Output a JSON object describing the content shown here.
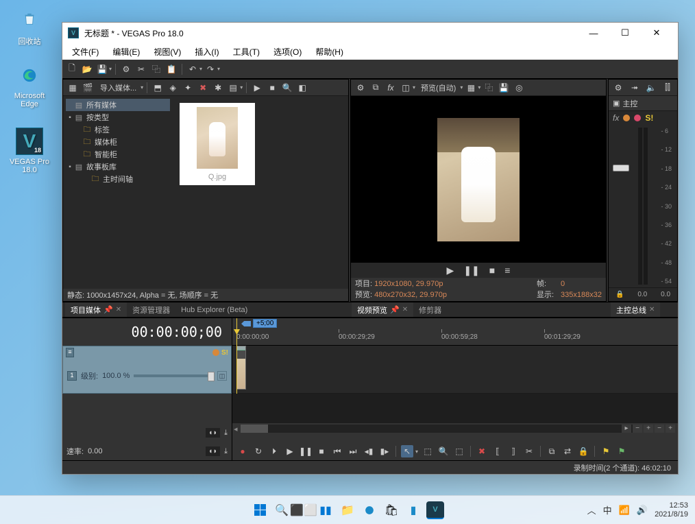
{
  "desktop": {
    "recycle": "回收站",
    "edge": "Microsoft\nEdge",
    "vegas": "VEGAS Pro\n18.0"
  },
  "window": {
    "title": "无标题 * - VEGAS Pro 18.0"
  },
  "menu": {
    "file": "文件(F)",
    "edit": "编辑(E)",
    "view": "视图(V)",
    "insert": "插入(I)",
    "tools": "工具(T)",
    "options": "选项(O)",
    "help": "帮助(H)"
  },
  "project_media": {
    "import_btn": "导入媒体...",
    "tree": {
      "all_media": "所有媒体",
      "by_type": "按类型",
      "tags": "标签",
      "media_bins": "媒体柜",
      "smart_bins": "智能柜",
      "storyboard": "故事板库",
      "main_timeline": "主时间轴"
    },
    "thumb_name": "Q.jpg",
    "status": "静态: 1000x1457x24, Alpha = 无, 场顺序 = 无"
  },
  "dock_tabs_left": {
    "project_media": "项目媒体",
    "explorer": "资源管理器",
    "hub": "Hub Explorer (Beta)"
  },
  "preview": {
    "quality_label": "预览(自动)",
    "project_label": "项目:",
    "project_val": "1920x1080, 29.970p",
    "frame_label": "帧:",
    "frame_val": "0",
    "preview_label": "预览:",
    "preview_val": "480x270x32, 29.970p",
    "display_label": "显示:",
    "display_val": "335x188x32"
  },
  "dock_tabs_center": {
    "video_preview": "视频预览",
    "trimmer": "修剪器"
  },
  "master": {
    "title": "主控",
    "scale": [
      "6",
      "12",
      "18",
      "24",
      "30",
      "36",
      "42",
      "48",
      "54"
    ],
    "val_left": "0.0",
    "val_right": "0.0"
  },
  "dock_tabs_right": {
    "master_bus": "主控总线"
  },
  "timeline": {
    "timecode": "00:00:00;00",
    "marker": "+5;00",
    "ruler": [
      "0:00:00;00",
      "00:00:29;29",
      "00:00:59;28",
      "00:01:29;29"
    ],
    "track_level_label": "级别:",
    "track_level_val": "100.0 %",
    "rate_label": "速率:",
    "rate_val": "0.00"
  },
  "status_bar": "录制时间(2 个通道): 46:02:10",
  "taskbar": {
    "lang": "中",
    "time": "12:53",
    "date": "2021/8/19"
  }
}
